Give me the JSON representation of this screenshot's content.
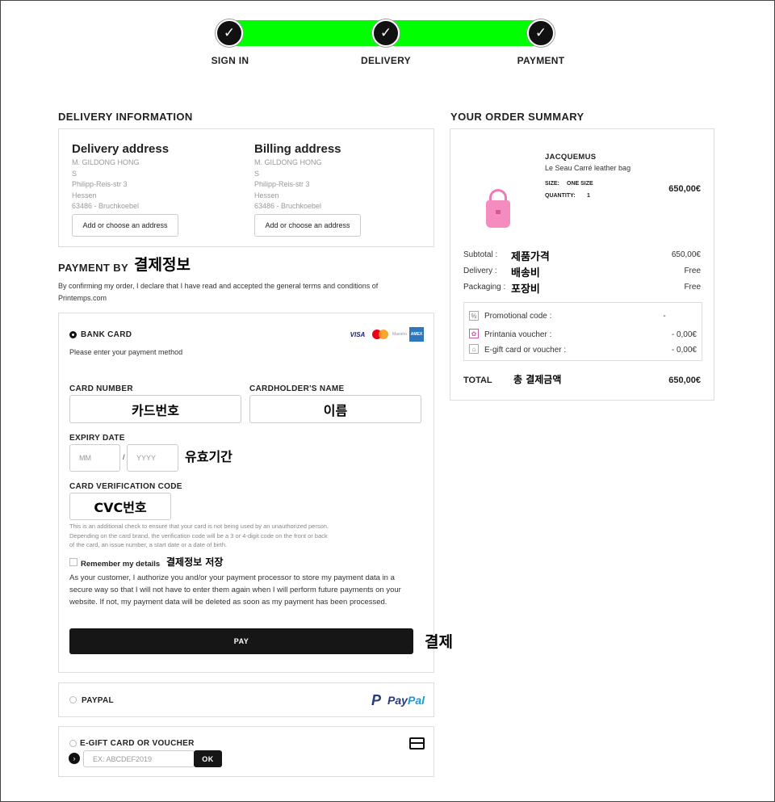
{
  "steps": [
    {
      "label": "SIGN IN"
    },
    {
      "label": "DELIVERY"
    },
    {
      "label": "PAYMENT"
    }
  ],
  "colors": {
    "progress": "#00ff00",
    "dark": "#161616",
    "paypal_dark": "#253b80",
    "paypal_light": "#179bd7"
  },
  "delivery": {
    "heading": "DELIVERY INFORMATION",
    "delivery_address": {
      "title": "Delivery address",
      "lines": [
        "M. GILDONG HONG",
        "S",
        "Philipp-Reis-str 3",
        "Hessen",
        "63486 - Bruchkoebel"
      ],
      "button": "Add or choose an address"
    },
    "billing_address": {
      "title": "Billing address",
      "lines": [
        "M. GILDONG HONG",
        "S",
        "Philipp-Reis-str 3",
        "Hessen",
        "63486 - Bruchkoebel"
      ],
      "button": "Add or choose an address"
    }
  },
  "payment": {
    "heading": "PAYMENT BY",
    "heading_annotation": "결제정보",
    "terms_text": "By confirming my order, I declare that I have read and accepted the general terms and conditions of Printemps.com",
    "bank_card": {
      "label": "BANK CARD",
      "instruction": "Please enter your payment method",
      "logos": [
        "VISA",
        "MasterCard",
        "Maestro",
        "AMEX"
      ],
      "card_number_label": "CARD NUMBER",
      "card_number_annotation": "카드번호",
      "cardholder_label": "CARDHOLDER'S NAME",
      "cardholder_annotation": "이름",
      "expiry_label": "EXPIRY DATE",
      "expiry_month_placeholder": "MM",
      "expiry_separator": "/",
      "expiry_year_placeholder": "YYYY",
      "expiry_annotation": "유효기간",
      "cvc_label": "CARD VERIFICATION CODE",
      "cvc_annotation": "CVC번호",
      "cvc_help": "This is an additional check to ensure that your card is not being used by an unauthorized person. Depending on the card brand, the verification code will be a 3 or 4-digit code on the front or back of the card, an issue number, a start date or a date of birth.",
      "remember_label": "Remember my details",
      "remember_annotation": "결제정보  저장",
      "remember_text": "As your customer, I authorize you and/or your payment processor to store my payment data in a secure way so that I will not have to enter them again when I will perform future payments on your website. If not, my payment data will be deleted as soon as my payment has been processed.",
      "pay_button": "PAY",
      "pay_annotation": "결제"
    },
    "paypal": {
      "label": "PAYPAL",
      "logo_pay": "Pay",
      "logo_pal": "Pal"
    },
    "gift": {
      "label": "E-GIFT CARD OR VOUCHER",
      "input_placeholder": "EX: ABCDEF2019",
      "ok_button": "OK"
    }
  },
  "summary": {
    "heading": "YOUR ORDER SUMMARY",
    "item": {
      "brand": "JACQUEMUS",
      "name": "Le Seau Carré leather bag",
      "size_label": "SIZE:",
      "size_value": "ONE SIZE",
      "quantity_label": "QUANTITY:",
      "quantity_value": "1",
      "price": "650,00€"
    },
    "rows": [
      {
        "label": "Subtotal :",
        "annotation": "제품가격",
        "value": "650,00€"
      },
      {
        "label": "Delivery :",
        "annotation": "배송비",
        "value": "Free"
      },
      {
        "label": "Packaging :",
        "annotation": "포장비",
        "value": "Free"
      }
    ],
    "promo": [
      {
        "icon": "percent-icon",
        "label": "Promotional code :",
        "value": "-"
      },
      {
        "icon": "voucher-icon",
        "label": "Printania voucher :",
        "value": "- 0,00€"
      },
      {
        "icon": "gift-card-icon",
        "label": "E-gift card or voucher :",
        "value": "- 0,00€"
      }
    ],
    "total_label": "TOTAL",
    "total_annotation": "총  결제금액",
    "total_value": "650,00€"
  }
}
